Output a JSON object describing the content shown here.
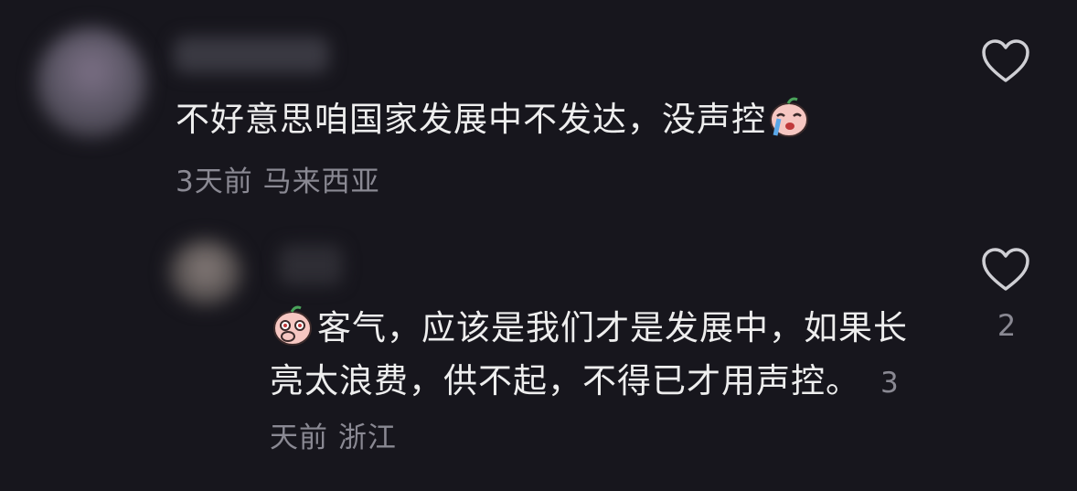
{
  "comments": [
    {
      "text": "不好意思咱国家发展中不发达，没声控",
      "emoji": "crying-peach-emoji",
      "time": "3天前",
      "location": "马来西亚",
      "like_icon": "heart-outline-icon"
    },
    {
      "text": "客气，应该是我们才是发展中，如果长亮太浪费，供不起，不得已才用声控。",
      "emoji": "shy-peach-emoji",
      "time": "3天前",
      "location": "浙江",
      "like_icon": "heart-outline-icon",
      "like_count": "2"
    }
  ],
  "colors": {
    "background": "#17161d",
    "text": "#eeeeee",
    "meta": "#8a8993",
    "icon": "#cfcfd4"
  }
}
